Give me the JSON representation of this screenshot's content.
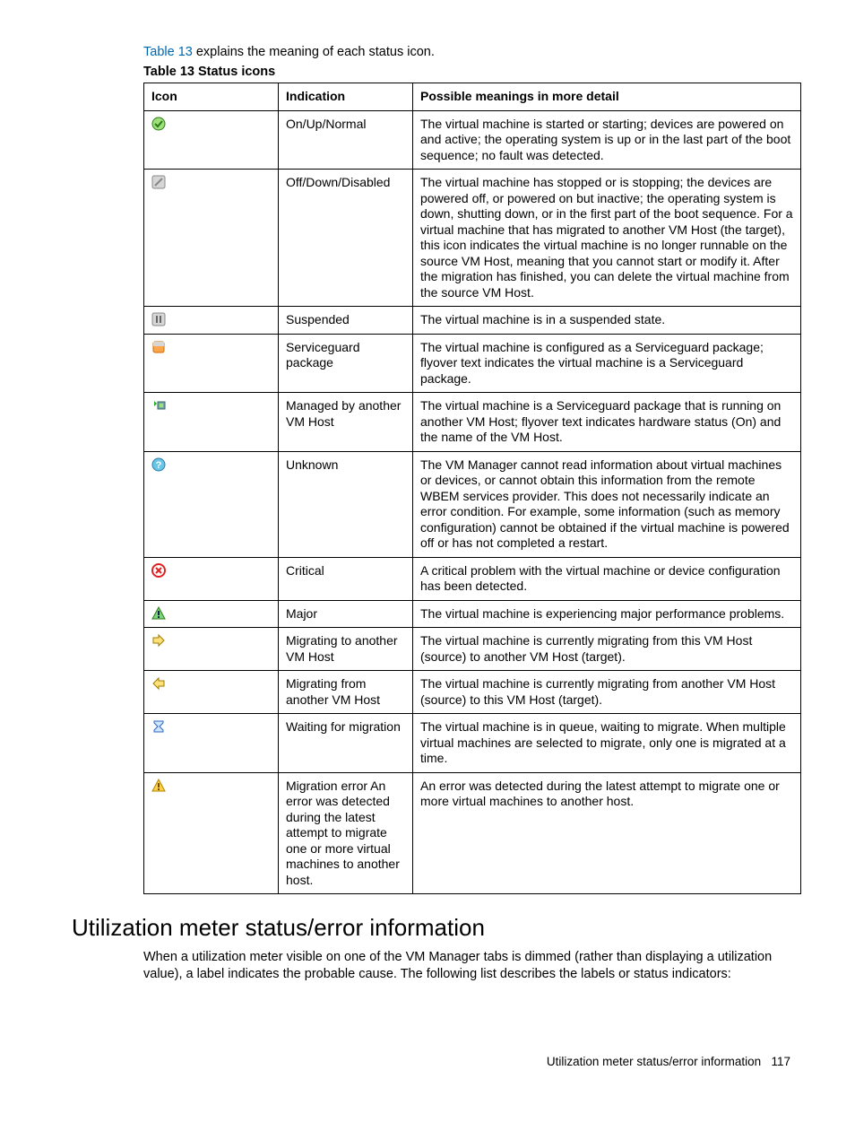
{
  "intro": {
    "link": "Table 13",
    "rest": " explains the meaning of each status icon."
  },
  "table": {
    "caption": "Table 13 Status icons",
    "headers": {
      "icon": "Icon",
      "indication": "Indication",
      "meaning": "Possible meanings in more detail"
    },
    "rows": [
      {
        "icon": "normal-icon",
        "indication": "On/Up/Normal",
        "meaning": "The virtual machine is started or starting; devices are powered on and active; the operating system is up or in the last part of the boot sequence; no fault was detected."
      },
      {
        "icon": "disabled-icon",
        "indication": "Off/Down/Disabled",
        "meaning": "The virtual machine has stopped or is stopping; the devices are powered off, or powered on but inactive; the operating system is down, shutting down, or in the first part of the boot sequence. For a virtual machine that has migrated to another VM Host (the target), this icon indicates the virtual machine is no longer runnable on the source VM Host, meaning that you cannot start or modify it. After the migration has finished, you can delete the virtual machine from the source VM Host."
      },
      {
        "icon": "suspended-icon",
        "indication": "Suspended",
        "meaning": "The virtual machine is in a suspended state."
      },
      {
        "icon": "serviceguard-icon",
        "indication": "Serviceguard package",
        "meaning": "The virtual machine is configured as a Serviceguard package; flyover text indicates the virtual machine is a Serviceguard package."
      },
      {
        "icon": "managed-other-icon",
        "indication": "Managed by another VM Host",
        "meaning": "The virtual machine is a Serviceguard package that is running on another VM Host; flyover text indicates hardware status (On) and the name of the VM Host."
      },
      {
        "icon": "unknown-icon",
        "indication": "Unknown",
        "meaning": "The VM Manager cannot read information about virtual machines or devices, or cannot obtain this information from the remote WBEM services provider. This does not necessarily indicate an error condition. For example, some information (such as memory configuration) cannot be obtained if the virtual machine is powered off or has not completed a restart."
      },
      {
        "icon": "critical-icon",
        "indication": "Critical",
        "meaning": "A critical problem with the virtual machine or device configuration has been detected."
      },
      {
        "icon": "major-icon",
        "indication": "Major",
        "meaning": "The virtual machine is experiencing major performance problems."
      },
      {
        "icon": "migrating-to-icon",
        "indication": "Migrating to another VM Host",
        "meaning": "The virtual machine is currently migrating from this VM Host (source) to another VM Host (target)."
      },
      {
        "icon": "migrating-from-icon",
        "indication": "Migrating from another VM Host",
        "meaning": "The virtual machine is currently migrating from another VM Host (source) to this VM Host (target)."
      },
      {
        "icon": "waiting-migration-icon",
        "indication": "Waiting for migration",
        "meaning": "The virtual machine is in queue, waiting to migrate. When multiple virtual machines are selected to migrate, only one is migrated at a time."
      },
      {
        "icon": "migration-error-icon",
        "indication": "Migration error An error was detected during the latest attempt to migrate one or more virtual machines to another host.",
        "meaning": "An error was detected during the latest attempt to migrate one or more virtual machines to another host."
      }
    ]
  },
  "section": {
    "heading": "Utilization meter status/error information",
    "body": "When a utilization meter visible on one of the VM Manager tabs is dimmed (rather than displaying a utilization value), a label indicates the probable cause. The following list describes the labels or status indicators:"
  },
  "footer": {
    "title": "Utilization meter status/error information",
    "page": "117"
  }
}
